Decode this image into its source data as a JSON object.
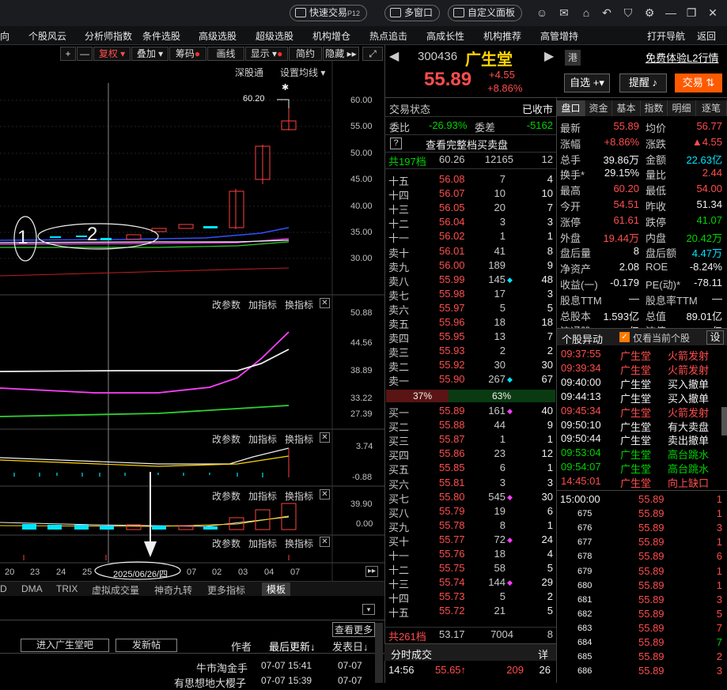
{
  "titlebar": {
    "quick_trade": "快速交易",
    "quick_trade_key": "P12",
    "multi_window": "多窗口",
    "custom_board": "自定义面板"
  },
  "menu": [
    "向",
    "个股风云",
    "分析师指数",
    "条件选股",
    "高级选股",
    "超级选股",
    "机构增仓",
    "热点追击",
    "高成长性",
    "机构推荐",
    "高管增持",
    "打开导航",
    "返回"
  ],
  "toolbar": {
    "plus": "+",
    "minus": "—",
    "fuquan": "复权",
    "overlay": "叠加",
    "chouma": "筹码",
    "draw": "画线",
    "show": "显示",
    "simple": "简约",
    "hide": "隐藏"
  },
  "chart_header": {
    "shengangtong": "深股通",
    "ma_setting": "设置均线"
  },
  "main_chart": {
    "y_ticks": [
      "60.00",
      "55.00",
      "50.00",
      "45.00",
      "40.00",
      "35.00",
      "30.00"
    ],
    "high_label": "60.20",
    "marker_1": "1",
    "marker_2": "2"
  },
  "sub_panels": [
    {
      "change_params": "改参数",
      "add_indicator": "加指标",
      "switch_indicator": "换指标",
      "y_ticks": [
        "50.88",
        "44.56",
        "38.89",
        "33.22",
        "27.39"
      ]
    },
    {
      "change_params": "改参数",
      "add_indicator": "加指标",
      "switch_indicator": "换指标",
      "y_ticks": [
        "3.74",
        "-0.88"
      ]
    },
    {
      "change_params": "改参数",
      "add_indicator": "加指标",
      "switch_indicator": "换指标",
      "y_ticks": [
        "39.90",
        "0.00"
      ]
    },
    {
      "change_params": "改参数",
      "add_indicator": "加指标",
      "switch_indicator": "换指标",
      "y_ticks": []
    }
  ],
  "date_axis": {
    "dates": [
      "20",
      "23",
      "24",
      "25",
      "07",
      "02",
      "03",
      "04",
      "07"
    ],
    "cursor_date": "2025/06/26/四"
  },
  "indicator_tabs": [
    "D",
    "DMA",
    "TRIX",
    "虚拟成交量",
    "神奇九转",
    "更多指标",
    "模板"
  ],
  "forum": {
    "more": "查看更多",
    "enter": "进入广生堂吧",
    "post": "发新帖",
    "col_author": "作者",
    "col_last_update": "最后更新",
    "col_post_date": "发表日",
    "rows": [
      {
        "author": "牛市淘金手",
        "last_update": "07-07 15:41",
        "post_date": "07-07"
      },
      {
        "author": "有思想地大樱子",
        "last_update": "07-07 15:39",
        "post_date": "07-07"
      }
    ]
  },
  "quote": {
    "code": "300436",
    "name": "广生堂",
    "hk_tag": "港",
    "l2_link": "免费体验L2行情",
    "price": "55.89",
    "change": "+4.55",
    "change_pct": "+8.86%",
    "watchlist": "自选",
    "alert": "提醒",
    "trade": "交易"
  },
  "order_book": {
    "status_label": "交易状态",
    "status_value": "已收市",
    "weibi_label": "委比",
    "weibi_value": "-26.93%",
    "weicha_label": "委差",
    "weicha_value": "-5162",
    "help_btn": "?",
    "full_depth": "查看完整档买卖盘",
    "sell_total": {
      "label": "共197档",
      "price": "60.26",
      "vol": "12165",
      "orders": "12"
    },
    "sells": [
      {
        "label": "十五",
        "price": "56.08",
        "vol": "7",
        "orders": "4",
        "mark": ""
      },
      {
        "label": "十四",
        "price": "56.07",
        "vol": "10",
        "orders": "10",
        "mark": ""
      },
      {
        "label": "十三",
        "price": "56.05",
        "vol": "20",
        "orders": "7",
        "mark": ""
      },
      {
        "label": "十二",
        "price": "56.04",
        "vol": "3",
        "orders": "3",
        "mark": ""
      },
      {
        "label": "十一",
        "price": "56.02",
        "vol": "1",
        "orders": "1",
        "mark": ""
      },
      {
        "label": "卖十",
        "price": "56.01",
        "vol": "41",
        "orders": "8",
        "mark": ""
      },
      {
        "label": "卖九",
        "price": "56.00",
        "vol": "189",
        "orders": "9",
        "mark": ""
      },
      {
        "label": "卖八",
        "price": "55.99",
        "vol": "145",
        "orders": "48",
        "mark": "cyan"
      },
      {
        "label": "卖七",
        "price": "55.98",
        "vol": "17",
        "orders": "3",
        "mark": ""
      },
      {
        "label": "卖六",
        "price": "55.97",
        "vol": "5",
        "orders": "5",
        "mark": ""
      },
      {
        "label": "卖五",
        "price": "55.96",
        "vol": "18",
        "orders": "18",
        "mark": ""
      },
      {
        "label": "卖四",
        "price": "55.95",
        "vol": "13",
        "orders": "7",
        "mark": ""
      },
      {
        "label": "卖三",
        "price": "55.93",
        "vol": "2",
        "orders": "2",
        "mark": ""
      },
      {
        "label": "卖二",
        "price": "55.92",
        "vol": "30",
        "orders": "30",
        "mark": ""
      },
      {
        "label": "卖一",
        "price": "55.90",
        "vol": "267",
        "orders": "67",
        "mark": "cyan"
      }
    ],
    "ratio_sell": "37%",
    "ratio_buy": "63%",
    "ratio_sell_fraction": 0.37,
    "buys": [
      {
        "label": "买一",
        "price": "55.89",
        "vol": "161",
        "orders": "40",
        "mark": "magenta"
      },
      {
        "label": "买二",
        "price": "55.88",
        "vol": "44",
        "orders": "9",
        "mark": ""
      },
      {
        "label": "买三",
        "price": "55.87",
        "vol": "1",
        "orders": "1",
        "mark": ""
      },
      {
        "label": "买四",
        "price": "55.86",
        "vol": "23",
        "orders": "12",
        "mark": ""
      },
      {
        "label": "买五",
        "price": "55.85",
        "vol": "6",
        "orders": "1",
        "mark": ""
      },
      {
        "label": "买六",
        "price": "55.81",
        "vol": "3",
        "orders": "3",
        "mark": ""
      },
      {
        "label": "买七",
        "price": "55.80",
        "vol": "545",
        "orders": "30",
        "mark": "magenta"
      },
      {
        "label": "买八",
        "price": "55.79",
        "vol": "19",
        "orders": "6",
        "mark": ""
      },
      {
        "label": "买九",
        "price": "55.78",
        "vol": "8",
        "orders": "1",
        "mark": ""
      },
      {
        "label": "买十",
        "price": "55.77",
        "vol": "72",
        "orders": "24",
        "mark": "magenta"
      },
      {
        "label": "十一",
        "price": "55.76",
        "vol": "18",
        "orders": "4",
        "mark": ""
      },
      {
        "label": "十二",
        "price": "55.75",
        "vol": "58",
        "orders": "5",
        "mark": ""
      },
      {
        "label": "十三",
        "price": "55.74",
        "vol": "144",
        "orders": "29",
        "mark": "magenta"
      },
      {
        "label": "十四",
        "price": "55.73",
        "vol": "5",
        "orders": "2",
        "mark": ""
      },
      {
        "label": "十五",
        "price": "55.72",
        "vol": "21",
        "orders": "5",
        "mark": ""
      }
    ],
    "buy_total": {
      "label": "共261档",
      "price": "53.17",
      "vol": "7004",
      "orders": "8"
    },
    "tick_title": "分时成交",
    "tick_detail": "详",
    "ticks": [
      {
        "time": "14:56",
        "price": "55.65",
        "vol": "209",
        "orders": "26"
      }
    ]
  },
  "info_tabs": [
    "盘口",
    "资金",
    "基本",
    "指数",
    "明细",
    "逐笔"
  ],
  "info": [
    {
      "l1": "最新",
      "v1": "55.89",
      "c1": "red",
      "l2": "均价",
      "v2": "56.77",
      "c2": "red"
    },
    {
      "l1": "涨幅",
      "v1": "+8.86%",
      "c1": "red",
      "l2": "涨跌",
      "v2": "▲4.55",
      "c2": "red"
    },
    {
      "l1": "总手",
      "v1": "39.86万",
      "c1": "white",
      "l2": "金额",
      "v2": "22.63亿",
      "c2": "cyan"
    },
    {
      "l1": "换手*",
      "v1": "29.15%",
      "c1": "white",
      "l2": "量比",
      "v2": "2.44",
      "c2": "red"
    },
    {
      "l1": "最高",
      "v1": "60.20",
      "c1": "red",
      "l2": "最低",
      "v2": "54.00",
      "c2": "red"
    },
    {
      "l1": "今开",
      "v1": "54.51",
      "c1": "red",
      "l2": "昨收",
      "v2": "51.34",
      "c2": "white"
    },
    {
      "l1": "涨停",
      "v1": "61.61",
      "c1": "red",
      "l2": "跌停",
      "v2": "41.07",
      "c2": "green"
    },
    {
      "l1": "外盘",
      "v1": "19.44万",
      "c1": "red",
      "l2": "内盘",
      "v2": "20.42万",
      "c2": "green"
    },
    {
      "l1": "盘后量",
      "v1": "8",
      "c1": "white",
      "l2": "盘后额",
      "v2": "4.47万",
      "c2": "cyan"
    },
    {
      "l1": "净资产",
      "v1": "2.08",
      "c1": "white",
      "l2": "ROE",
      "v2": "-8.24%",
      "c2": "white"
    },
    {
      "l1": "收益(一)",
      "v1": "-0.179",
      "c1": "white",
      "l2": "PE(动)*",
      "v2": "-78.11",
      "c2": "white"
    },
    {
      "l1": "股息TTM",
      "v1": "—",
      "c1": "white",
      "l2": "股息率TTM",
      "v2": "—",
      "c2": "white"
    },
    {
      "l1": "总股本",
      "v1": "1.593亿",
      "c1": "white",
      "l2": "总值",
      "v2": "89.01亿",
      "c2": "white"
    },
    {
      "l1": "流通股",
      "v1": "1.367亿",
      "c1": "white",
      "l2": "流值",
      "v2": "76.41亿",
      "c2": "white"
    }
  ],
  "movement": {
    "title": "个股异动",
    "only_current": "仅看当前个股",
    "settings": "设",
    "rows": [
      {
        "time": "09:37:55",
        "name": "广生堂",
        "event": "火箭发射",
        "color": "red"
      },
      {
        "time": "09:39:34",
        "name": "广生堂",
        "event": "火箭发射",
        "color": "red"
      },
      {
        "time": "09:40:00",
        "name": "广生堂",
        "event": "买入撤单",
        "color": "white"
      },
      {
        "time": "09:44:13",
        "name": "广生堂",
        "event": "买入撤单",
        "color": "white"
      },
      {
        "time": "09:45:34",
        "name": "广生堂",
        "event": "火箭发射",
        "color": "red"
      },
      {
        "time": "09:50:10",
        "name": "广生堂",
        "event": "有大卖盘",
        "color": "white"
      },
      {
        "time": "09:50:44",
        "name": "广生堂",
        "event": "卖出撤单",
        "color": "white"
      },
      {
        "time": "09:53:04",
        "name": "广生堂",
        "event": "高台跳水",
        "color": "green"
      },
      {
        "time": "09:54:07",
        "name": "广生堂",
        "event": "高台跳水",
        "color": "green"
      },
      {
        "time": "14:45:01",
        "name": "广生堂",
        "event": "向上缺口",
        "color": "red"
      }
    ]
  },
  "detail": [
    {
      "t": "15:00:00",
      "p": "55.89",
      "v": "1",
      "vc": "red"
    },
    {
      "t": "675",
      "p": "55.89",
      "v": "1",
      "vc": "red"
    },
    {
      "t": "676",
      "p": "55.89",
      "v": "3",
      "vc": "red"
    },
    {
      "t": "677",
      "p": "55.89",
      "v": "1",
      "vc": "red"
    },
    {
      "t": "678",
      "p": "55.89",
      "v": "6",
      "vc": "red"
    },
    {
      "t": "679",
      "p": "55.89",
      "v": "1",
      "vc": "red"
    },
    {
      "t": "680",
      "p": "55.89",
      "v": "1",
      "vc": "red"
    },
    {
      "t": "681",
      "p": "55.89",
      "v": "3",
      "vc": "red"
    },
    {
      "t": "682",
      "p": "55.89",
      "v": "5",
      "vc": "red"
    },
    {
      "t": "683",
      "p": "55.89",
      "v": "7",
      "vc": "red"
    },
    {
      "t": "684",
      "p": "55.89",
      "v": "7",
      "vc": "green"
    },
    {
      "t": "685",
      "p": "55.89",
      "v": "2",
      "vc": "red"
    },
    {
      "t": "686",
      "p": "55.89",
      "v": "3",
      "vc": "red"
    }
  ]
}
